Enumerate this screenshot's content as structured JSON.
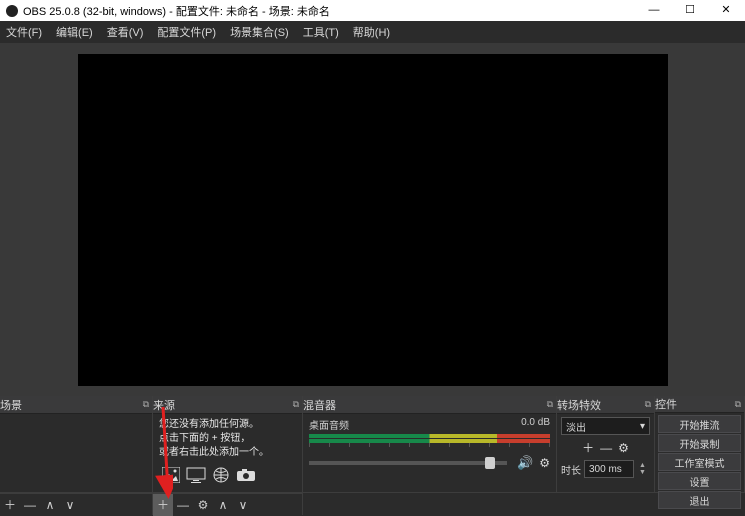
{
  "window": {
    "title": "OBS 25.0.8 (32-bit, windows) - 配置文件: 未命名 - 场景: 未命名"
  },
  "menu": {
    "file": "文件(F)",
    "edit": "编辑(E)",
    "view": "查看(V)",
    "profile": "配置文件(P)",
    "scene_collection": "场景集合(S)",
    "tools": "工具(T)",
    "help": "帮助(H)"
  },
  "panels": {
    "scenes": "场景",
    "sources": "来源",
    "mixer": "混音器",
    "transitions": "转场特效",
    "controls": "控件"
  },
  "sources_hint": {
    "line1": "您还没有添加任何源。",
    "line2": "点击下面的 + 按钮，",
    "line3": "或者右击此处添加一个。"
  },
  "mixer": {
    "track_name": "桌面音频",
    "track_db": "0.0 dB"
  },
  "transitions": {
    "selected": "淡出",
    "duration_label": "时长",
    "duration_value": "300 ms"
  },
  "controls": {
    "start_stream": "开始推流",
    "start_record": "开始录制",
    "studio_mode": "工作室模式",
    "settings": "设置",
    "exit": "退出"
  },
  "glyphs": {
    "plus": "＋",
    "minus": "—",
    "gear": "⚙",
    "up": "∧",
    "down": "∨",
    "speaker": "🔊",
    "popout": "⧉",
    "chevron": "▾"
  }
}
